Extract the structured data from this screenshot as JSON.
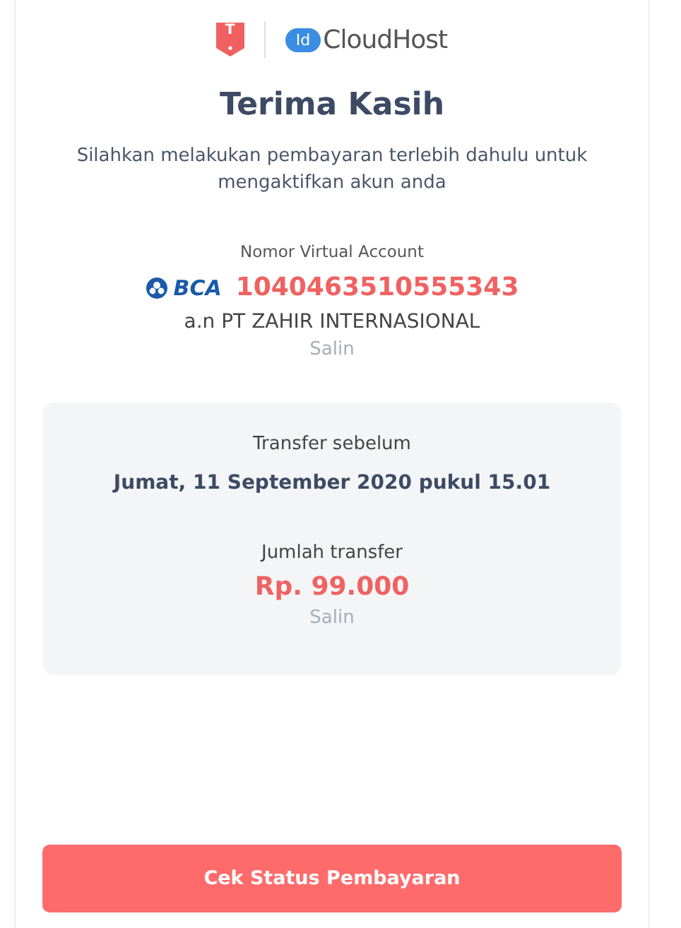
{
  "logo": {
    "badge": "T",
    "cloud_mark": "Id",
    "brand": "CloudHost"
  },
  "title": "Terima Kasih",
  "subtitle": "Silahkan melakukan pembayaran terlebih dahulu untuk mengaktifkan akun anda",
  "virtual_account": {
    "label": "Nomor Virtual Account",
    "bank": "BCA",
    "number": "1040463510555343",
    "holder": "a.n PT ZAHIR INTERNASIONAL",
    "copy": "Salin"
  },
  "transfer": {
    "deadline_label": "Transfer sebelum",
    "deadline": "Jumat, 11 September 2020 pukul 15.01",
    "amount_label": "Jumlah transfer",
    "amount": "Rp. 99.000",
    "copy": "Salin"
  },
  "button": "Cek Status Pembayaran"
}
